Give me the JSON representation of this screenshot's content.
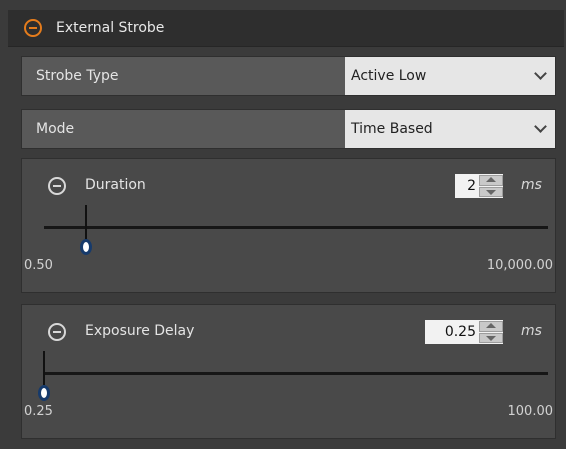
{
  "header": {
    "title": "External Strobe"
  },
  "strobe_type": {
    "label": "Strobe Type",
    "value": "Active Low"
  },
  "mode": {
    "label": "Mode",
    "value": "Time Based"
  },
  "duration": {
    "title": "Duration",
    "value": "2",
    "unit": "ms",
    "min_label": "0.50",
    "max_label": "10,000.00",
    "slider_fraction": 0.0001
  },
  "exposure_delay": {
    "title": "Exposure Delay",
    "value": "0.25",
    "unit": "ms",
    "min_label": "0.25",
    "max_label": "100.00",
    "slider_fraction": 0.0
  },
  "colors": {
    "accent": "#e57c1c",
    "thumb_border": "#163a6b"
  }
}
